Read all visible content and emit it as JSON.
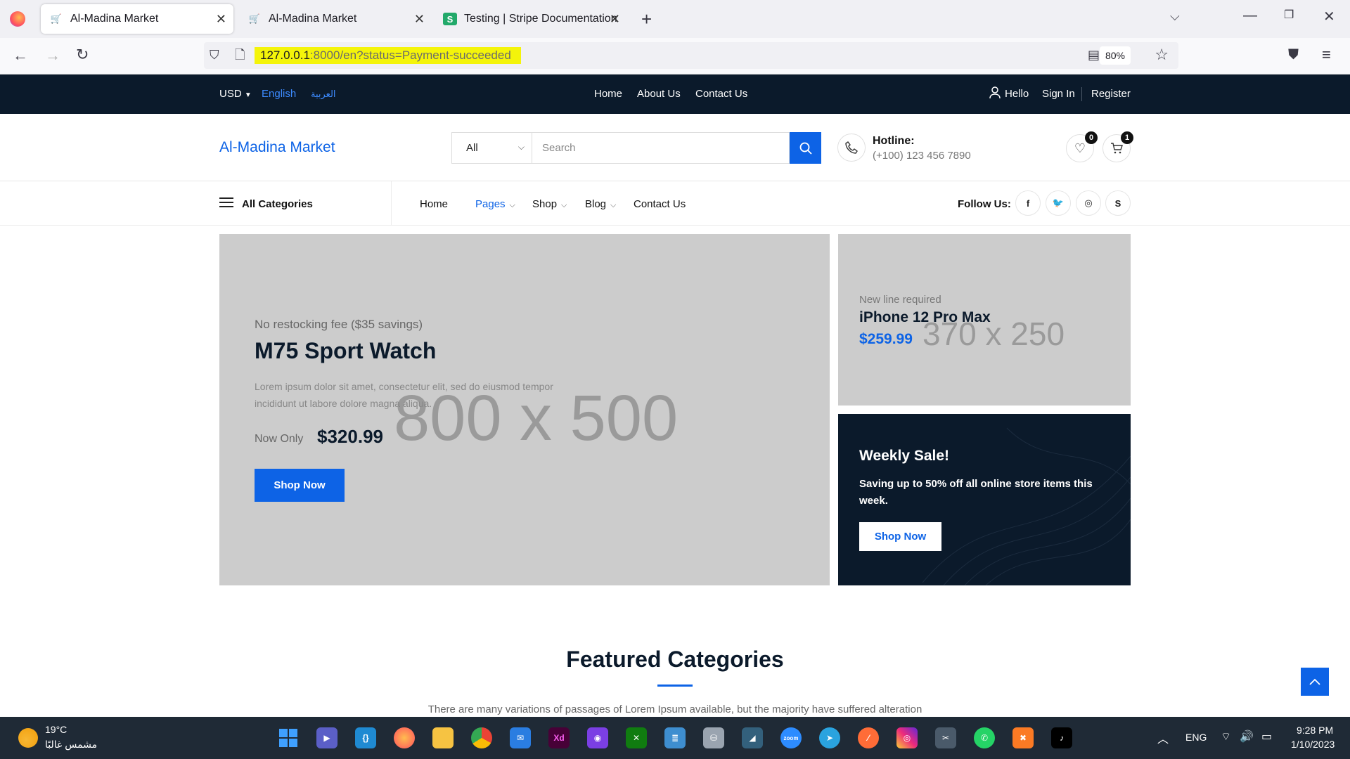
{
  "browser": {
    "tabs": [
      {
        "title": "Al-Madina Market",
        "active": true
      },
      {
        "title": "Al-Madina Market",
        "active": false
      },
      {
        "title": "Testing | Stripe Documentation",
        "active": false
      }
    ],
    "url_host": "127.0.0.1",
    "url_rest": ":8000/en?status=Payment-succeeded",
    "zoom": "80%"
  },
  "topbar": {
    "currency": "USD",
    "lang_en": "English",
    "lang_ar": "العربية",
    "links": [
      "Home",
      "About Us",
      "Contact Us"
    ],
    "hello": "Hello",
    "sign_in": "Sign In",
    "register": "Register"
  },
  "header": {
    "logo": "Al-Madina Market",
    "category_select": "All",
    "search_placeholder": "Search",
    "hotline_label": "Hotline:",
    "hotline_number": "(+100) 123 456 7890",
    "wishlist_count": "0",
    "cart_count": "1"
  },
  "nav": {
    "all_categories": "All Categories",
    "items": [
      "Home",
      "Pages",
      "Shop",
      "Blog",
      "Contact Us"
    ],
    "follow_us": "Follow Us:"
  },
  "hero": {
    "main": {
      "placeholder": "800 x 500",
      "subtitle": "No restocking fee ($35 savings)",
      "title": "M75 Sport Watch",
      "description_line1": "Lorem ipsum dolor sit amet, consectetur elit, sed do eiusmod tempor",
      "description_line2": "incididunt ut labore dolore magna aliqua.",
      "now_only": "Now Only",
      "price": "$320.99",
      "button": "Shop Now"
    },
    "side1": {
      "placeholder": "370 x 250",
      "subtitle": "New line required",
      "title": "iPhone 12 Pro Max",
      "price": "$259.99"
    },
    "side2": {
      "title": "Weekly Sale!",
      "text_line1": "Saving up to 50% off all online store items this",
      "text_line2": "week.",
      "button": "Shop Now"
    }
  },
  "featured": {
    "title": "Featured Categories",
    "subtitle": "There are many variations of passages of Lorem Ipsum available, but the majority have suffered alteration"
  },
  "taskbar": {
    "weather_temp": "19°C",
    "weather_desc": "مشمس غالبًا",
    "lang": "ENG",
    "time": "9:28 PM",
    "date": "1/10/2023"
  },
  "colors": {
    "accent": "#0d63e6",
    "dark": "#0b1a2b",
    "placeholder_gray": "#cccccc",
    "url_highlight": "#f4f40a"
  }
}
